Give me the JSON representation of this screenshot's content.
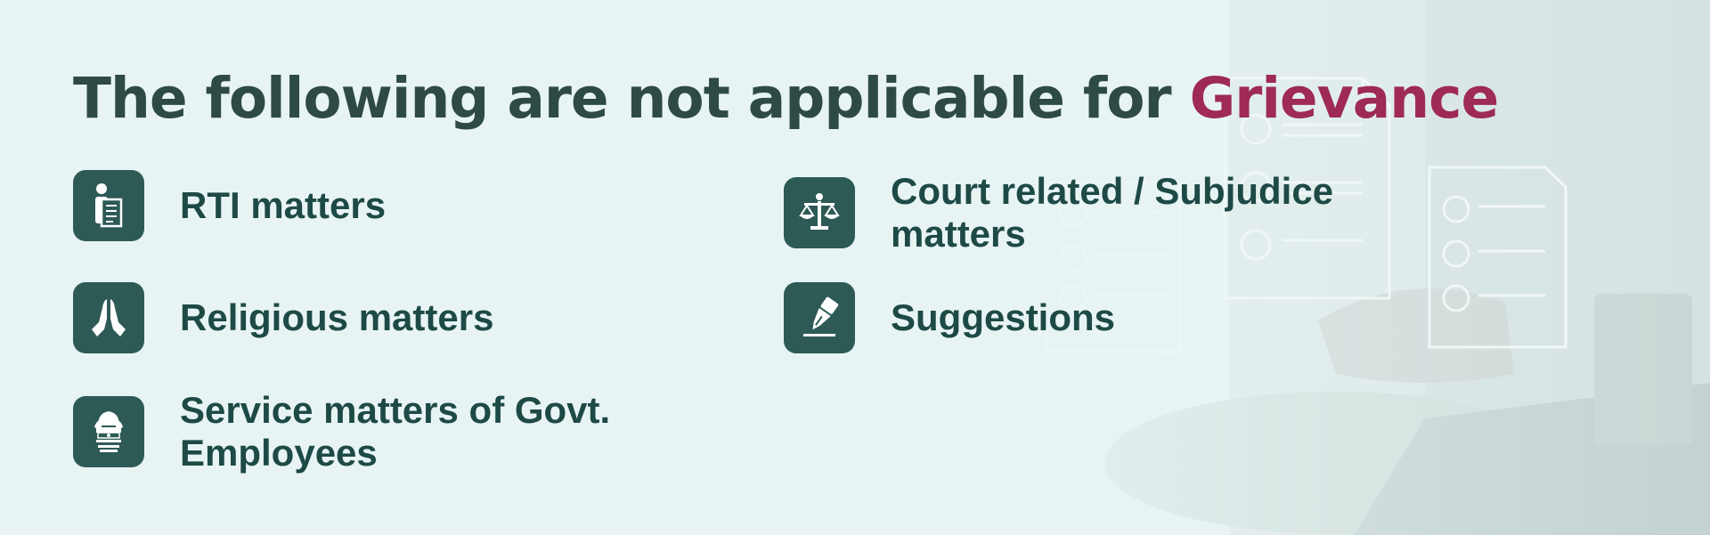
{
  "heading": {
    "prefix": "The following are not applicable for",
    "highlight": "Grievance"
  },
  "items": [
    {
      "label": "RTI matters",
      "icon": "rti-document-person-icon"
    },
    {
      "label": "Court related / Subjudice matters",
      "icon": "scales-of-justice-icon"
    },
    {
      "label": "Religious matters",
      "icon": "folded-hands-icon"
    },
    {
      "label": "Suggestions",
      "icon": "pen-signing-icon"
    },
    {
      "label": "Service matters of Govt. Employees",
      "icon": "national-emblem-icon"
    }
  ],
  "colors": {
    "heading": "#2e4a47",
    "highlight": "#9e2a55",
    "icon_bg": "#2e5a56",
    "label": "#1e4a46",
    "background": "#e8f4f4"
  }
}
